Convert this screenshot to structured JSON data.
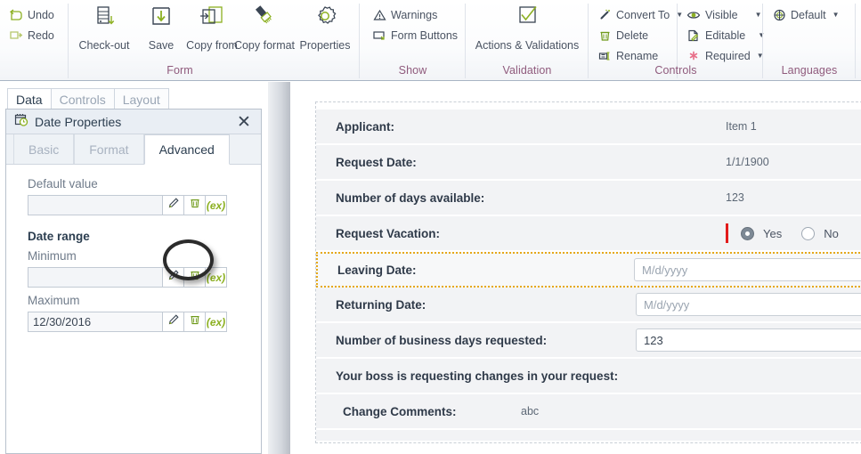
{
  "ribbon": {
    "groups": [
      {
        "title": "Form",
        "quick": [
          {
            "label": "Undo",
            "icon": "undo-icon"
          },
          {
            "label": "Redo",
            "icon": "redo-icon"
          }
        ],
        "buttons": [
          {
            "label": "Check-out",
            "icon": "check-out-icon"
          },
          {
            "label": "Save",
            "icon": "save-icon"
          },
          {
            "label": "Copy from",
            "icon": "copy-from-icon"
          },
          {
            "label": "Copy format",
            "icon": "copy-format-icon"
          },
          {
            "label": "Properties",
            "icon": "properties-gear-icon"
          }
        ]
      },
      {
        "title": "Show",
        "items": [
          {
            "label": "Warnings",
            "icon": "warning-triangle-icon"
          },
          {
            "label": "Form Buttons",
            "icon": "form-buttons-icon"
          }
        ]
      },
      {
        "title": "Validation",
        "buttons": [
          {
            "label": "Actions & Validations",
            "icon": "checkmark-box-icon"
          }
        ]
      },
      {
        "title": "Controls",
        "items": [
          {
            "label": "Convert To",
            "icon": "convert-to-icon",
            "caret": true
          },
          {
            "label": "Delete",
            "icon": "trash-icon",
            "caret": false
          },
          {
            "label": "Rename",
            "icon": "rename-icon",
            "caret": false
          },
          {
            "label": "Visible",
            "icon": "eye-icon",
            "caret": true
          },
          {
            "label": "Editable",
            "icon": "editable-pencil-icon",
            "caret": true
          },
          {
            "label": "Required",
            "icon": "required-asterisk-icon",
            "caret": true
          }
        ]
      },
      {
        "title": "Languages",
        "items": [
          {
            "label": "Default",
            "icon": "globe-icon",
            "caret": true
          }
        ]
      }
    ]
  },
  "left_panel": {
    "tabs": [
      {
        "label": "Data",
        "active": true
      },
      {
        "label": "Controls",
        "active": false
      },
      {
        "label": "Layout",
        "active": false
      }
    ],
    "dialog": {
      "title": "Date Properties",
      "title_icon": "calendar-clock-icon",
      "close_icon": "close-icon",
      "tabs": [
        {
          "label": "Basic",
          "active": false
        },
        {
          "label": "Format",
          "active": false
        },
        {
          "label": "Advanced",
          "active": true
        }
      ],
      "fields": [
        {
          "label": "Default value",
          "bold": false,
          "value": "",
          "buttons": [
            "pencil-icon",
            "trash-icon",
            "expression-icon"
          ]
        },
        {
          "label": "Minimum",
          "bold": false,
          "value": "",
          "buttons": [
            "pencil-icon",
            "trash-icon",
            "expression-icon"
          ]
        },
        {
          "label": "Maximum",
          "bold": false,
          "value": "12/30/2016",
          "buttons": [
            "pencil-icon",
            "trash-icon",
            "expression-icon"
          ]
        }
      ],
      "section_heading": "Date range",
      "expression_label": "(ex)",
      "highlight": "annotation-ellipse"
    }
  },
  "form": {
    "rows": [
      {
        "label": "Applicant:",
        "value": "Item 1",
        "kind": "text"
      },
      {
        "label": "Request Date:",
        "value": "1/1/1900",
        "kind": "text"
      },
      {
        "label": "Number of days available:",
        "value": "123",
        "kind": "text"
      },
      {
        "label": "Request Vacation:",
        "kind": "radio",
        "options": [
          {
            "label": "Yes",
            "selected": true
          },
          {
            "label": "No",
            "selected": false
          }
        ]
      },
      {
        "label": "Leaving Date:",
        "value": "M/d/yyyy",
        "kind": "input",
        "placeholder": true,
        "selected": true
      },
      {
        "label": "Returning Date:",
        "value": "M/d/yyyy",
        "kind": "input",
        "placeholder": true
      },
      {
        "label": "Number of business days requested:",
        "value": "123",
        "kind": "input",
        "placeholder": false
      },
      {
        "label": "Your boss is requesting changes in your request:",
        "value": "",
        "kind": "text"
      },
      {
        "label": "Change Comments:",
        "value": "abc",
        "kind": "text",
        "indent": true
      }
    ]
  },
  "colors": {
    "accent_green": "#8cb021",
    "accent_navy": "#3a4553",
    "group_title": "#8f5a7c",
    "selection_orange": "#e6a817",
    "required_red": "#e21b1b"
  }
}
